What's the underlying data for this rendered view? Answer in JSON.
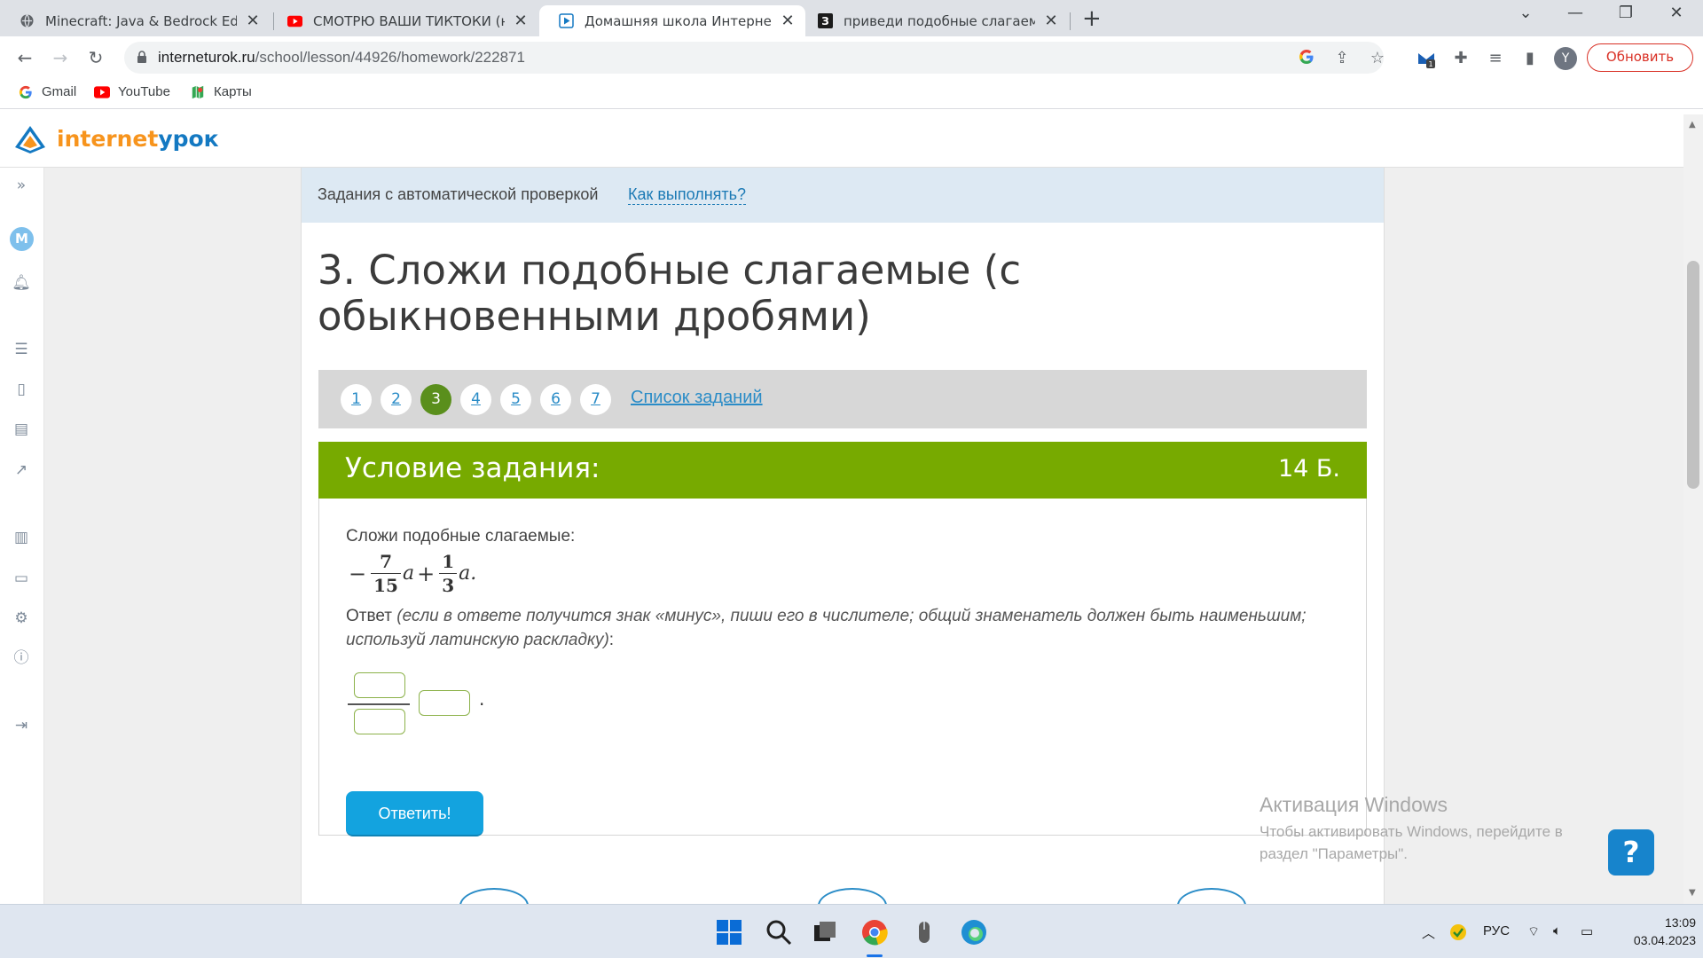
{
  "browser": {
    "tabs": [
      {
        "title": "Minecraft: Java & Bedrock Editio",
        "icon": "globe-icon",
        "active": false
      },
      {
        "title": "СМОТРЮ ВАШИ ТИКТОКИ (не с",
        "icon": "youtube-icon",
        "active": false
      },
      {
        "title": "Домашняя школа ИнтернетУро",
        "icon": "play-icon",
        "active": true
      },
      {
        "title": "приведи подобные слагаемые",
        "icon": "znanija-icon",
        "active": false
      }
    ],
    "address": {
      "host": "interneturok.ru",
      "path": "/school/lesson/44926/homework/222871"
    },
    "profile_initial": "Y",
    "extension_badge": "1",
    "update_label": "Обновить",
    "bookmarks": [
      {
        "label": "Gmail",
        "icon": "google-icon"
      },
      {
        "label": "YouTube",
        "icon": "youtube-icon"
      },
      {
        "label": "Карты",
        "icon": "maps-icon"
      }
    ]
  },
  "site": {
    "logo": {
      "part1": "internet",
      "part2": "урок"
    },
    "rail_avatar": "М"
  },
  "lesson": {
    "auto_check_label": "Задания с автоматической проверкой",
    "how_to_link": "Как выполнять?",
    "title": "3. Сложи подобные слагаемые (с обыкновенными дробями)",
    "pager": {
      "pages": [
        "1",
        "2",
        "3",
        "4",
        "5",
        "6",
        "7"
      ],
      "current": "3",
      "list_link": "Список заданий"
    },
    "task": {
      "header": "Условие задания:",
      "points": "14 Б.",
      "prompt": "Сложи подобные слагаемые:",
      "expression": {
        "sign": "−",
        "frac1": {
          "num": "7",
          "den": "15"
        },
        "var": "a",
        "plus": "+",
        "frac2": {
          "num": "1",
          "den": "3"
        },
        "tail": "a."
      },
      "answer_label": "Ответ",
      "answer_hint": "(если в ответе получится знак «минус», пиши его в числителе; общий знаменатель должен быть наименьшим; используй латинскую раскладку)",
      "answer_colon": ":",
      "answer_dot": ".",
      "fields": {
        "numerator": "",
        "denominator": "",
        "variable": ""
      },
      "submit_label": "Ответить!"
    }
  },
  "windows": {
    "activation_title": "Активация Windows",
    "activation_text": "Чтобы активировать Windows, перейдите в раздел \"Параметры\".",
    "help_glyph": "?",
    "tray": {
      "language": "РУС",
      "time": "13:09",
      "date": "03.04.2023"
    }
  },
  "colors": {
    "task_green": "#77aa00",
    "page_current": "#5a8f1c",
    "link_blue": "#2a8cc7",
    "submit_blue": "#13a3df",
    "update_red": "#d93025"
  }
}
